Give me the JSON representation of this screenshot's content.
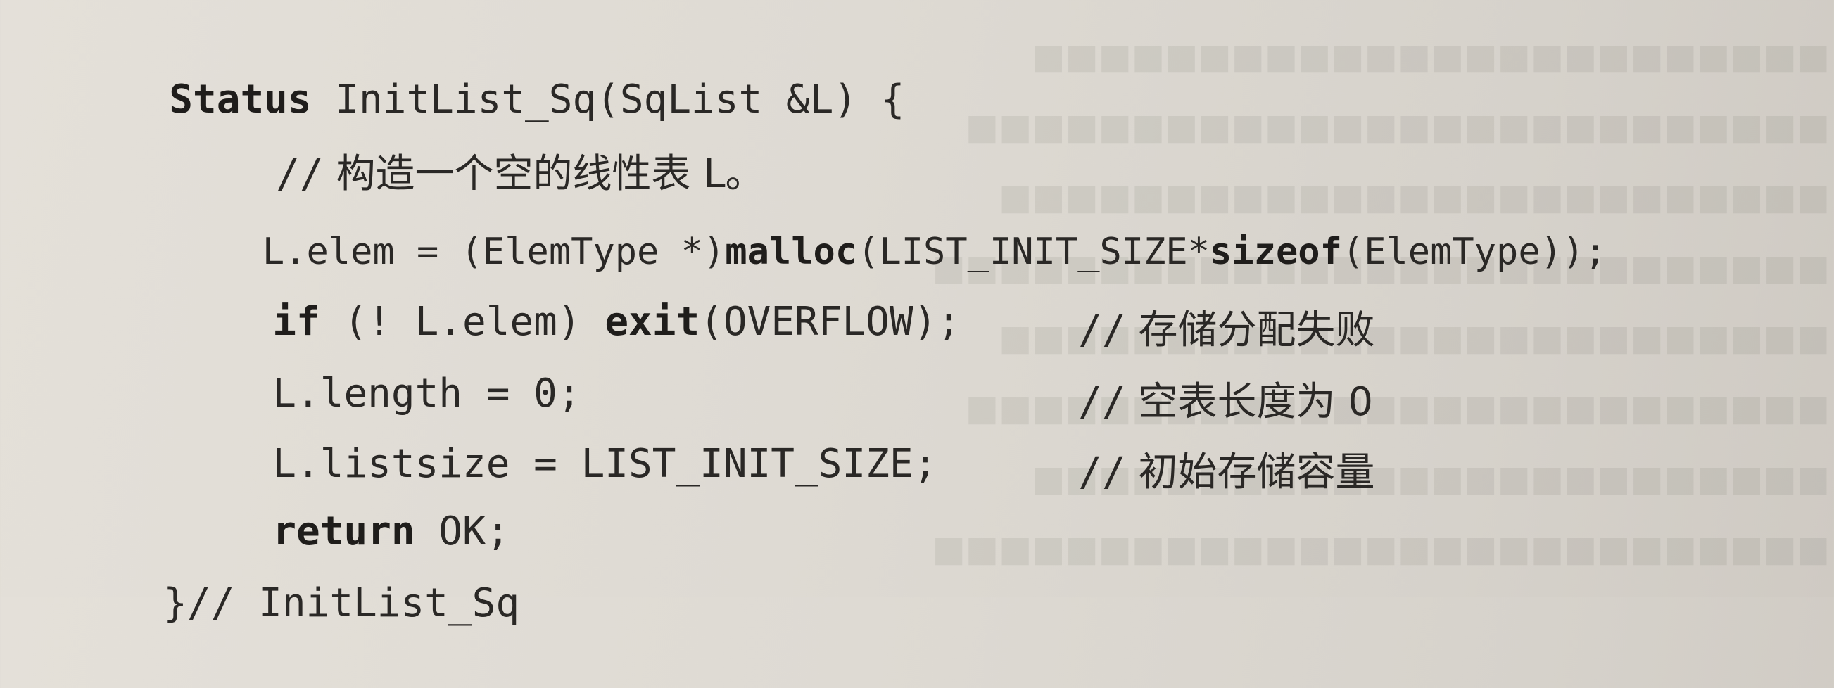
{
  "code": {
    "line1": {
      "kw_status": "Status",
      "rest": " InitList_Sq(SqList &L) {"
    },
    "line2": {
      "slashes": "//",
      "text": " 构造一个空的线性表 L。"
    },
    "line3": {
      "part1": "L.elem = (ElemType *)",
      "kw_malloc": "malloc",
      "part2": "(LIST_INIT_SIZE*",
      "kw_sizeof": "sizeof",
      "part3": "(ElemType));"
    },
    "line4": {
      "kw_if": "if",
      "part1": " (! L.elem) ",
      "kw_exit": "exit",
      "part2": "(OVERFLOW);",
      "comment_slashes": "//",
      "comment_text": " 存储分配失败"
    },
    "line5": {
      "code": "L.length = 0;",
      "comment_slashes": "//",
      "comment_text": " 空表长度为 0"
    },
    "line6": {
      "code": "L.listsize = LIST_INIT_SIZE;",
      "comment_slashes": "//",
      "comment_text": " 初始存储容量"
    },
    "line7": {
      "kw_return": "return",
      "rest": " OK;"
    },
    "line8": {
      "brace": "}",
      "slashes": "//",
      "text": " InitList_Sq"
    }
  }
}
